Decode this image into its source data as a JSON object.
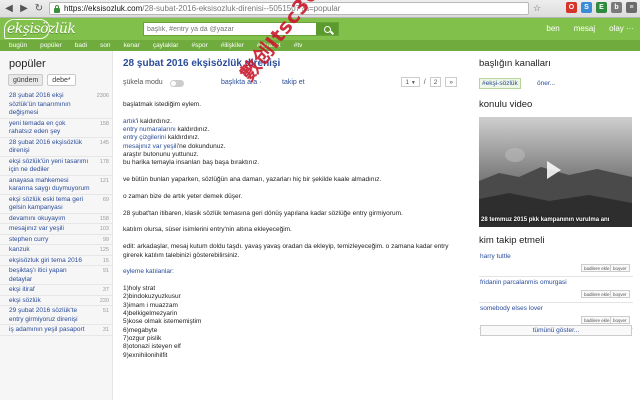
{
  "browser": {
    "url_host": "https://eksisozluk.com",
    "url_path": "/28-subat-2016-eksisozluk-direnisi--5051507?a=popular",
    "extensions": [
      {
        "label": "O",
        "color": "#d6332a"
      },
      {
        "label": "S",
        "color": "#3b8bd6"
      },
      {
        "label": "E",
        "color": "#2d8a3e"
      },
      {
        "label": "b",
        "color": "#7a7a7a"
      },
      {
        "label": "≡",
        "color": "#6a6a6a"
      }
    ]
  },
  "header": {
    "logo": "ekşisözlük",
    "search_placeholder": "başlık, #entry ya da @yazar",
    "links": [
      "ben",
      "mesaj",
      "olay ···"
    ]
  },
  "channels": [
    "bugün",
    "popüler",
    "badi",
    "son",
    "kenar",
    "çaylaklar",
    "#spor",
    "#ilişkiler",
    "#siyaset",
    "#tv"
  ],
  "sidebar": {
    "title": "popüler",
    "tabs": [
      "gündem",
      "debe*"
    ],
    "topics": [
      {
        "text": "28 şubat 2016 ekşi sözlük'ün tanarımının değişmesi",
        "count": "2306"
      },
      {
        "text": "yeni temada en çok rahatsız eden şey",
        "count": "158"
      },
      {
        "text": "28 şubat 2016 ekşisözlük direnişi",
        "count": "145"
      },
      {
        "text": "ekşi sözlük'ün yeni tasarımı için ne dediler",
        "count": "178"
      },
      {
        "text": "anayasa mahkemesi kararına saygı duymuyorum",
        "count": "121"
      },
      {
        "text": "ekşi sözlük eski tema geri gelsin kampanyası",
        "count": "69"
      },
      {
        "text": "devamını okuyayım",
        "count": "158"
      },
      {
        "text": "mesajınız var yeşili",
        "count": "103"
      },
      {
        "text": "stephen curry",
        "count": "99"
      },
      {
        "text": "kanzuk",
        "count": "125"
      },
      {
        "text": "ekşisözluk giri tema 2016",
        "count": "15"
      },
      {
        "text": "beşiktaş'ı itici yapan detaylar",
        "count": "91"
      },
      {
        "text": "ekşi itiraf",
        "count": "37"
      },
      {
        "text": "ekşi sözlük",
        "count": "220"
      },
      {
        "text": "29 şubat 2016 sözlük'te entry girmiyoruz direnişi",
        "count": "51"
      },
      {
        "text": "iş adamının yeşil pasaport",
        "count": "31"
      }
    ]
  },
  "main": {
    "title": "28 şubat 2016 ekşisözlük direnişi",
    "toolbar": {
      "mode": "şükela modu",
      "search_in": "başlıkta ara ·",
      "follow": "takip et",
      "page_current": "1",
      "page_sep": "/",
      "page_total": "2",
      "page_next": "»"
    },
    "entry_lines": [
      {
        "text": "başlatmak istediğim eylem.",
        "style": "normal"
      },
      {
        "text": "",
        "style": "gap"
      },
      {
        "text": "artık'i kaldırdınız.",
        "style": "link_start",
        "link": "artık"
      },
      {
        "text": "entry numaralarını kaldırdınız.",
        "style": "link_start",
        "link": "entry numaralarını"
      },
      {
        "text": "entry çizgilerini kaldırdınız.",
        "style": "link_start",
        "link": "entry çizgilerini"
      },
      {
        "text": "mesajınız var yeşili'ne dokundunuz.",
        "style": "link_start",
        "link": "mesajınız var yeşili"
      },
      {
        "text": "araştır butonunu yuttunuz.",
        "style": "normal"
      },
      {
        "text": "bu harika temayla insanları baş başa bıraktınız.",
        "style": "normal"
      },
      {
        "text": "",
        "style": "gap"
      },
      {
        "text": "ve bütün bunları yaparken, sözlüğün ana damarı, yazarları hiç bir şekilde kaale almadınız.",
        "style": "normal"
      },
      {
        "text": "",
        "style": "gap"
      },
      {
        "text": "o zaman bize de artık yeter demek düşer.",
        "style": "normal"
      },
      {
        "text": "",
        "style": "gap"
      },
      {
        "text": "28 şubat'tan itibaren, klasik sözlük temasına geri dönüş yapılana kadar sözlüğe entry girmiyorum.",
        "style": "normal"
      },
      {
        "text": "",
        "style": "gap"
      },
      {
        "text": "katılım olursa, süser isimlerini entry'nin altına ekleyeceğim.",
        "style": "normal"
      },
      {
        "text": "",
        "style": "gap"
      },
      {
        "text": "edit: arkadaşlar, mesaj kutum doldu taşdı. yavaş yavaş oradan da ekleyip, temizleyeceğim. o zamana kadar entry girerek katılım talebinizi gösterebilirsiniz.",
        "style": "normal"
      },
      {
        "text": "",
        "style": "gap"
      },
      {
        "text": "eyleme katılanlar:",
        "style": "link"
      },
      {
        "text": "",
        "style": "gap"
      },
      {
        "text": "1)holy strat",
        "style": "normal"
      },
      {
        "text": "2)bindokuzyuzkusur",
        "style": "normal"
      },
      {
        "text": "3)imam i muazzam",
        "style": "normal"
      },
      {
        "text": "4)belkigelmezyarin",
        "style": "normal"
      },
      {
        "text": "5)kose olmak istememiştim",
        "style": "normal"
      },
      {
        "text": "6)megabyte",
        "style": "normal"
      },
      {
        "text": "7)ozgur pislik",
        "style": "normal"
      },
      {
        "text": "8)otonazi isteyen elf",
        "style": "normal"
      },
      {
        "text": "9)exnihilonihilfit",
        "style": "normal"
      }
    ]
  },
  "watermark": "數创Itsc360",
  "right": {
    "channels_title": "başlığın kanalları",
    "channel": "#ekşi-sözlük",
    "channel_more": "öner...",
    "video_title": "konulu video",
    "video_caption": "28 temmuz 2015 pkk kampanının vurulma anı",
    "follow_title": "kim takip etmeli",
    "follow_people": [
      "harry tuttle",
      "fridanin parcalanmis omurgasi",
      "somebody elses lover"
    ],
    "btn_follow": "badilere ekle",
    "btn_block": "boşver",
    "more": "tümünü göster..."
  }
}
